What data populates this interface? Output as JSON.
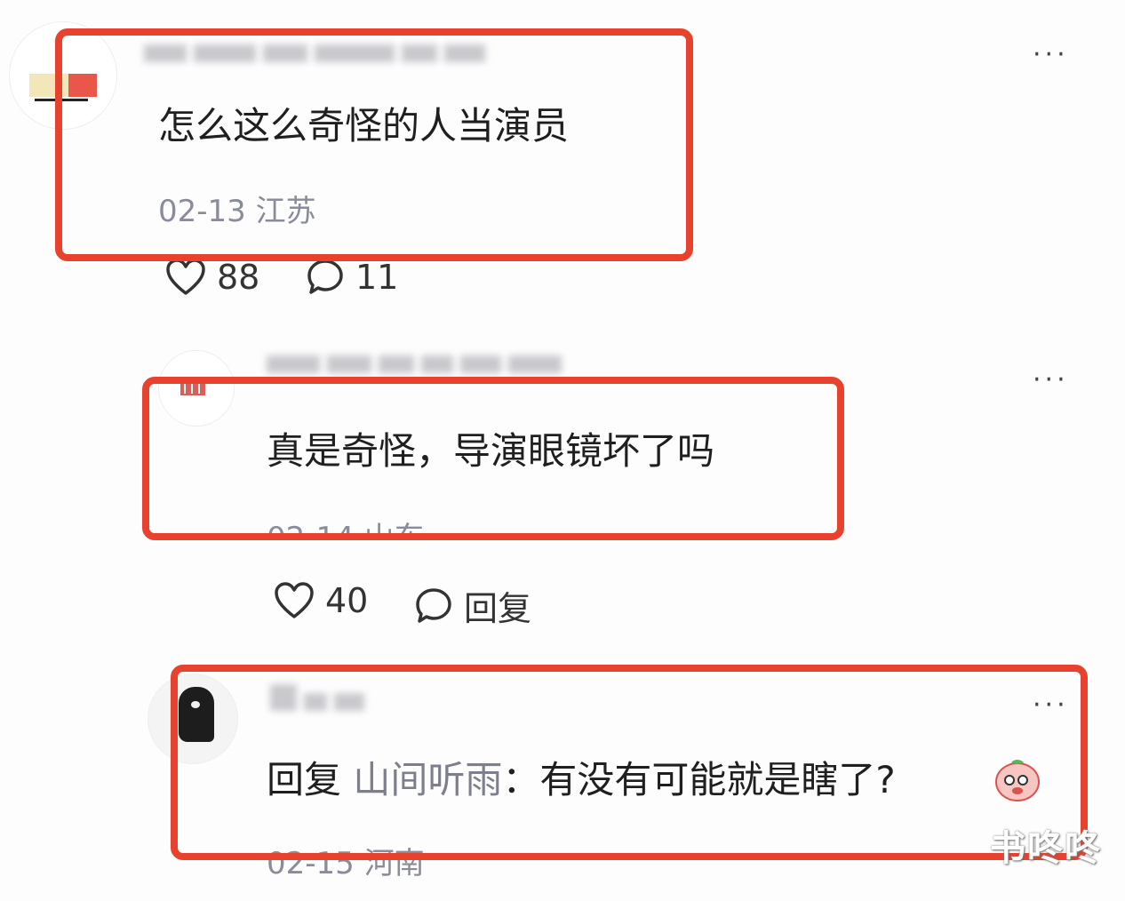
{
  "comments": [
    {
      "text": "怎么这么奇怪的人当演员",
      "meta": "02-13 江苏",
      "likes": "88",
      "replies": "11"
    },
    {
      "text": "真是奇怪，导演眼镜坏了吗",
      "meta": "02-14 山东",
      "likes": "40",
      "reply_label": "回复"
    },
    {
      "reply_prefix": "回复",
      "mention": "山间听雨",
      "separator": "：",
      "text": "有没有可能就是瞎了?",
      "meta": "02-15 河南"
    }
  ],
  "more_label": "···",
  "watermark": "书咚咚",
  "colors": {
    "highlight": "#e8412e",
    "meta_text": "#8a8d99",
    "background": "#fdfdfe"
  },
  "icons": [
    "heart-icon",
    "comment-bubble-icon",
    "more-icon",
    "peach-emoji-icon"
  ]
}
